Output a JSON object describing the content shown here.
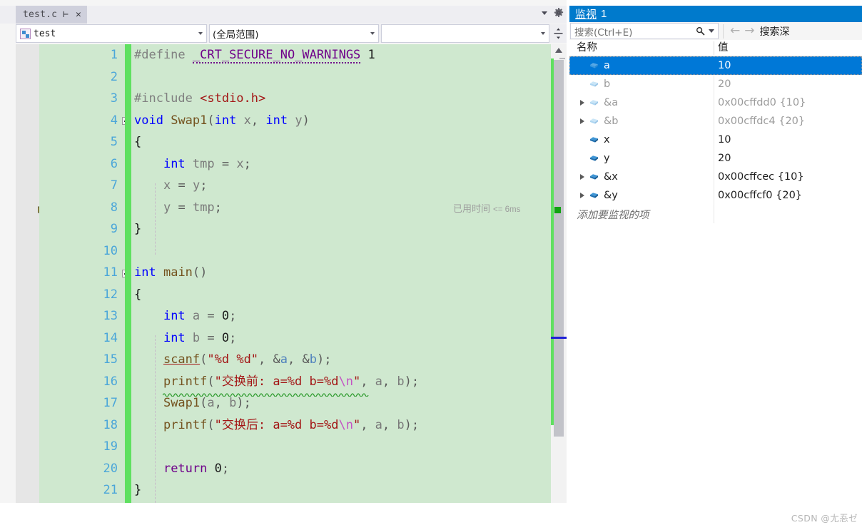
{
  "editor": {
    "tab": {
      "title": "test.c",
      "pin_icon": "pin-icon",
      "close_icon": "close-icon"
    },
    "tab_tools": {
      "dropdown_icon": "chevron-down-icon",
      "settings_icon": "gear-icon"
    },
    "navbar": {
      "scope_value": "test",
      "member_value": "(全局范围)",
      "extra_value": "",
      "splitter_icon": "split-window-icon"
    },
    "elapsed_annotation": {
      "label": "已用时间",
      "value": "<= 6ms"
    },
    "exec_pointer_line": 6,
    "lines": [
      {
        "n": "1",
        "text": "#define _CRT_SECURE_NO_WARNINGS 1"
      },
      {
        "n": "2",
        "text": ""
      },
      {
        "n": "3",
        "text": "#include <stdio.h>"
      },
      {
        "n": "4",
        "text": "void Swap1(int x, int y)"
      },
      {
        "n": "5",
        "text": "{"
      },
      {
        "n": "6",
        "text": "    int tmp = x;"
      },
      {
        "n": "7",
        "text": "    x = y;"
      },
      {
        "n": "8",
        "text": "    y = tmp;"
      },
      {
        "n": "9",
        "text": "}"
      },
      {
        "n": "10",
        "text": ""
      },
      {
        "n": "11",
        "text": "int main()"
      },
      {
        "n": "12",
        "text": "{"
      },
      {
        "n": "13",
        "text": "    int a = 0;"
      },
      {
        "n": "14",
        "text": "    int b = 0;"
      },
      {
        "n": "15",
        "text": "    scanf(\"%d %d\", &a, &b);"
      },
      {
        "n": "16",
        "text": "    printf(\"交换前: a=%d b=%d\\n\", a, b);"
      },
      {
        "n": "17",
        "text": "    Swap1(a, b);"
      },
      {
        "n": "18",
        "text": "    printf(\"交换后: a=%d b=%d\\n\", a, b);"
      },
      {
        "n": "19",
        "text": ""
      },
      {
        "n": "20",
        "text": "    return 0;"
      },
      {
        "n": "21",
        "text": "}"
      }
    ]
  },
  "watch": {
    "title_label": "监视",
    "title_number": "1",
    "search_placeholder": "搜索(Ctrl+E)",
    "search_icon": "search-icon",
    "search_dropdown_icon": "chevron-down-icon",
    "prev_icon": "arrow-left-icon",
    "next_icon": "arrow-right-icon",
    "search_depth_label": "搜索深",
    "columns": {
      "name": "名称",
      "value": "值"
    },
    "rows": [
      {
        "name": "a",
        "value": "10",
        "expandable": false,
        "selected": true,
        "stale": true
      },
      {
        "name": "b",
        "value": "20",
        "expandable": false,
        "selected": false,
        "stale": true
      },
      {
        "name": "&a",
        "value": "0x00cffdd0 {10}",
        "expandable": true,
        "selected": false,
        "stale": true
      },
      {
        "name": "&b",
        "value": "0x00cffdc4 {20}",
        "expandable": true,
        "selected": false,
        "stale": true
      },
      {
        "name": "x",
        "value": "10",
        "expandable": false,
        "selected": false,
        "stale": false
      },
      {
        "name": "y",
        "value": "20",
        "expandable": false,
        "selected": false,
        "stale": false
      },
      {
        "name": "&x",
        "value": "0x00cffcec {10}",
        "expandable": true,
        "selected": false,
        "stale": false
      },
      {
        "name": "&y",
        "value": "0x00cffcf0 {20}",
        "expandable": true,
        "selected": false,
        "stale": false
      }
    ],
    "add_item_placeholder": "添加要监视的项"
  },
  "watermark": "CSDN @尢忢ゼ",
  "colors": {
    "watch_title_bg": "#007acc",
    "selection_bg": "#0078d7",
    "modified_line_bg": "#cfe8cf",
    "change_bar": "#5fe060",
    "line_number": "#4ba6d9",
    "string": "#a31515",
    "keyword": "#0000ff",
    "macro": "#6f008a",
    "function": "#74531f"
  }
}
